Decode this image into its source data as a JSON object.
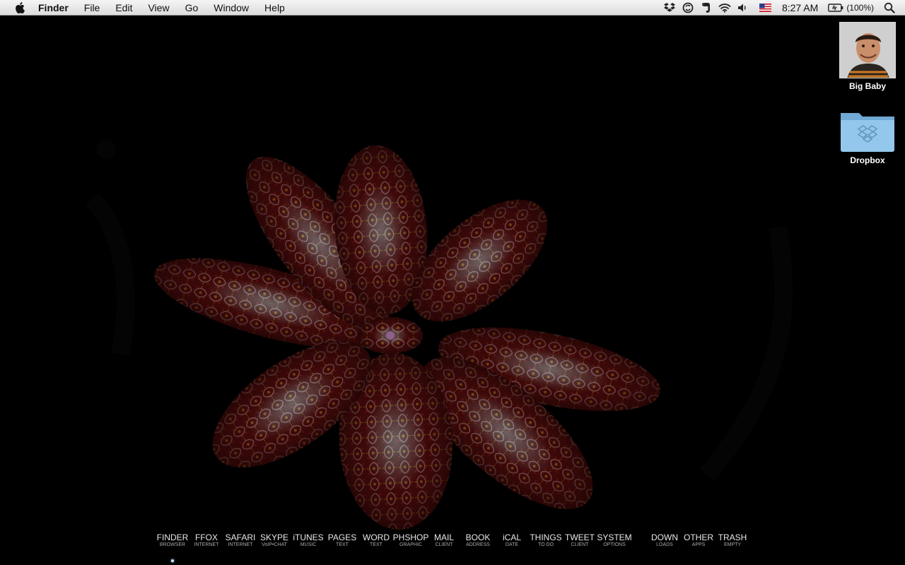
{
  "menubar": {
    "apple_icon": "apple-icon",
    "app_name": "Finder",
    "menus": [
      "File",
      "Edit",
      "View",
      "Go",
      "Window",
      "Help"
    ],
    "status": {
      "icons": [
        "dropbox-icon",
        "sync-icon",
        "evernote-icon",
        "wifi-icon",
        "volume-icon",
        "us-flag-icon"
      ],
      "clock": "8:27 AM",
      "battery": "(100%)"
    }
  },
  "desktop": {
    "icons": [
      {
        "label": "Big Baby",
        "kind": "photo"
      },
      {
        "label": "Dropbox",
        "kind": "folder"
      }
    ]
  },
  "dock": {
    "items": [
      {
        "main": "FINDER",
        "sub": "BROWSER"
      },
      {
        "main": "FFOX",
        "sub": "INTERNET"
      },
      {
        "main": "SAFARI",
        "sub": "INTERNET"
      },
      {
        "main": "SKYPE",
        "sub": "VoIP•CHAT"
      },
      {
        "main": "iTUNES",
        "sub": "MUSIC"
      },
      {
        "main": "PAGES",
        "sub": "TEXT"
      },
      {
        "main": "WORD",
        "sub": "TEXT"
      },
      {
        "main": "PHSHOP",
        "sub": "GRAPHIC"
      },
      {
        "main": "MAIL",
        "sub": "CLIENT"
      },
      {
        "main": "BOOK",
        "sub": "ADDRESS"
      },
      {
        "main": "iCAL",
        "sub": "DATE"
      },
      {
        "main": "THINGS",
        "sub": "TO DO"
      },
      {
        "main": "TWEET",
        "sub": "CLIENT"
      },
      {
        "main": "SYSTEM",
        "sub": "OPTIONS"
      },
      {
        "main": "DOWN",
        "sub": "LOADS"
      },
      {
        "main": "OTHER",
        "sub": "APPS"
      },
      {
        "main": "TRASH",
        "sub": "EMPTY"
      }
    ]
  },
  "colors": {
    "menubar": "#e6e6e6",
    "desktop": "#000000",
    "glass_red": "#8a1010",
    "glass_white": "#d8d8d8",
    "glass_gold": "#b89a20",
    "folder_blue": "#8ec3e6"
  }
}
